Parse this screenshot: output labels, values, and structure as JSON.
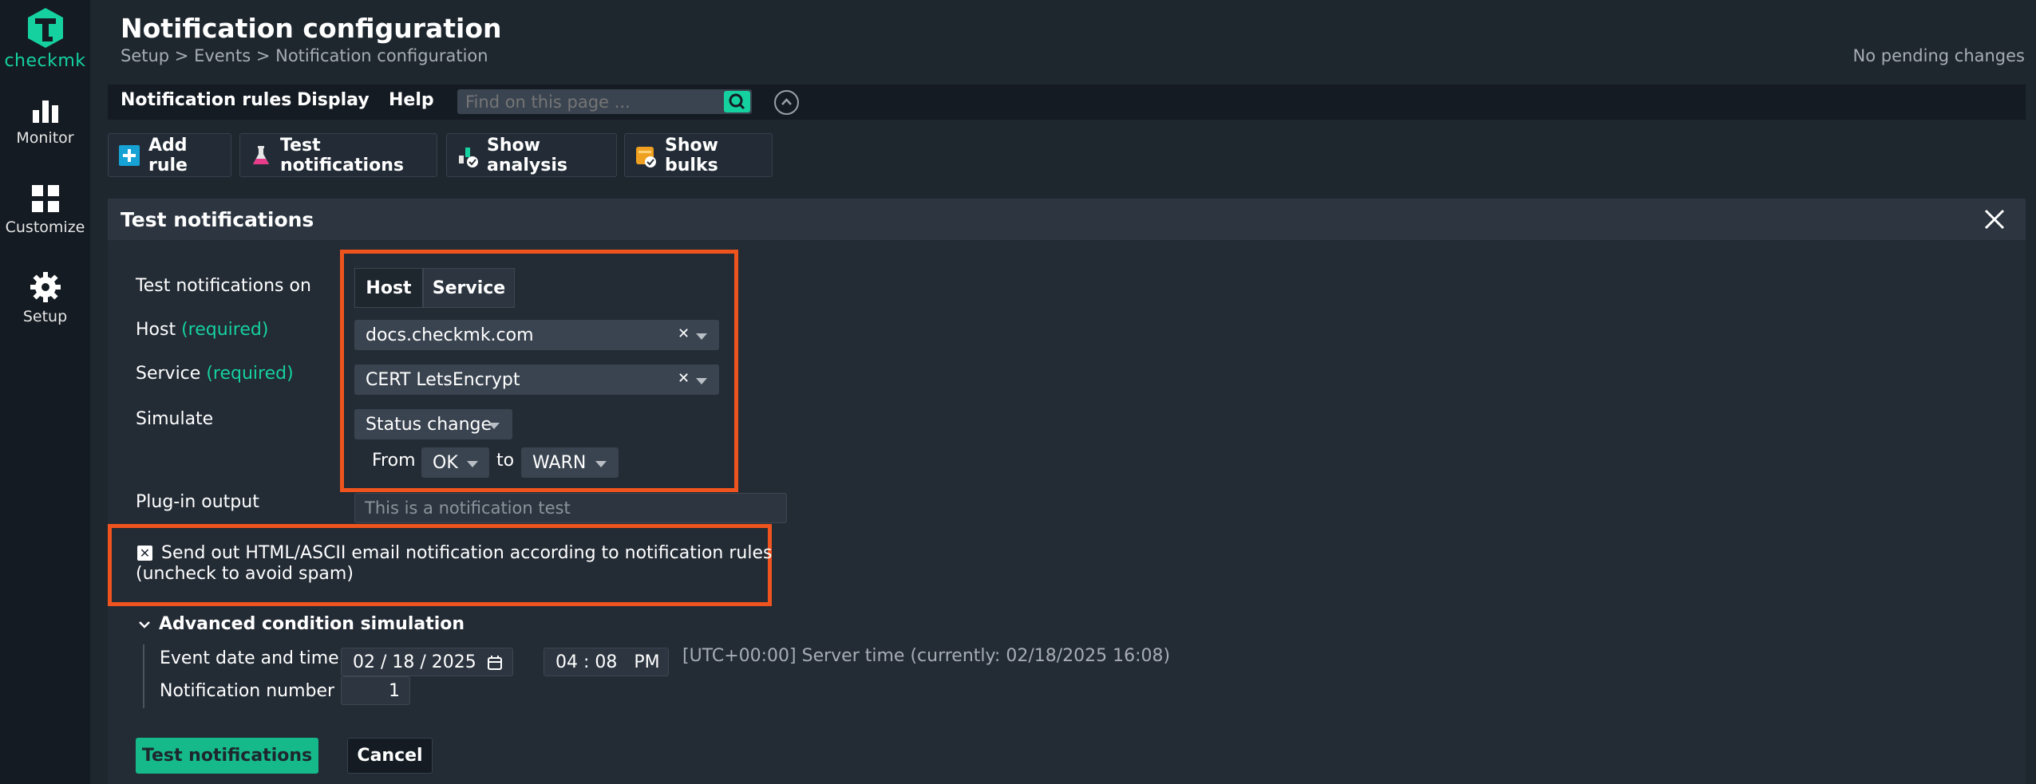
{
  "app": {
    "logo_text": "checkmk",
    "nav": [
      {
        "label": "Monitor",
        "icon": "monitor-icon"
      },
      {
        "label": "Customize",
        "icon": "customize-icon"
      },
      {
        "label": "Setup",
        "icon": "gear-icon"
      }
    ]
  },
  "header": {
    "title": "Notification configuration",
    "breadcrumb": "Setup > Events > Notification configuration",
    "pending": "No pending changes"
  },
  "menubar": {
    "items": [
      "Notification rules",
      "Display",
      "Help"
    ],
    "search_placeholder": "Find on this page ..."
  },
  "toolbar": {
    "add_rule": "Add rule",
    "test_notifications": "Test notifications",
    "show_analysis": "Show analysis",
    "show_bulks": "Show bulks"
  },
  "panel": {
    "title": "Test notifications",
    "fields": {
      "test_on_label": "Test notifications on",
      "test_on_options": [
        "Host",
        "Service"
      ],
      "test_on_selected": "Host",
      "host_label": "Host",
      "host_required": "(required)",
      "host_value": "docs.checkmk.com",
      "service_label": "Service",
      "service_required": "(required)",
      "service_value": "CERT LetsEncrypt",
      "simulate_label": "Simulate",
      "simulate_value": "Status change",
      "from_label": "From",
      "from_value": "OK",
      "to_label": "to",
      "to_value": "WARN",
      "plugin_label": "Plug-in output",
      "plugin_placeholder": "This is a notification test"
    },
    "checkbox": {
      "checked": true,
      "line1": "Send out HTML/ASCII email notification according to notification rules",
      "line2": "(uncheck to avoid spam)"
    },
    "advanced": {
      "title": "Advanced condition simulation",
      "event_label": "Event date and time",
      "date_value": "02 / 18 / 2025",
      "time_value": "04 : 08   PM",
      "server_time": "[UTC+00:00] Server time (currently: 02/18/2025 16:08)",
      "number_label": "Notification number",
      "number_value": "1"
    },
    "buttons": {
      "submit": "Test notifications",
      "cancel": "Cancel"
    }
  },
  "colors": {
    "accent": "#15d1a0",
    "highlight": "#f0541e",
    "background": "#1e262e",
    "sidebar": "#141b22"
  }
}
